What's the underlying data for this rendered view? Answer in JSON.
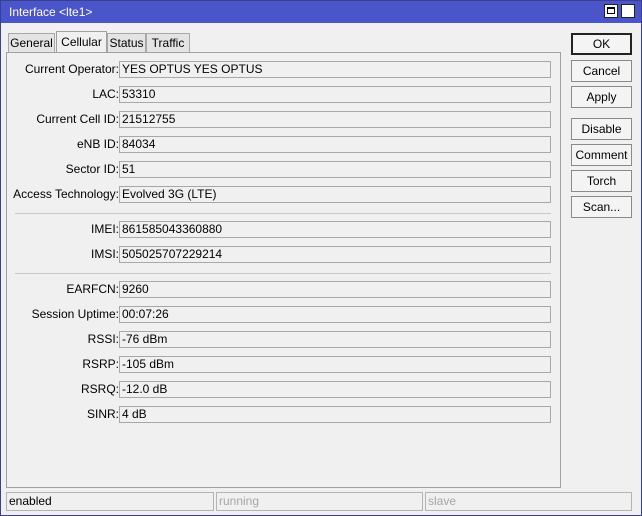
{
  "window": {
    "title": "Interface <lte1>"
  },
  "tabs": [
    {
      "label": "General"
    },
    {
      "label": "Cellular"
    },
    {
      "label": "Status"
    },
    {
      "label": "Traffic"
    }
  ],
  "fields": {
    "current_operator": {
      "label": "Current Operator:",
      "value": "YES OPTUS YES OPTUS"
    },
    "lac": {
      "label": "LAC:",
      "value": "53310"
    },
    "current_cell_id": {
      "label": "Current Cell ID:",
      "value": "21512755"
    },
    "enb_id": {
      "label": "eNB ID:",
      "value": "84034"
    },
    "sector_id": {
      "label": "Sector ID:",
      "value": "51"
    },
    "access_technology": {
      "label": "Access Technology:",
      "value": "Evolved 3G (LTE)"
    },
    "imei": {
      "label": "IMEI:",
      "value": "861585043360880"
    },
    "imsi": {
      "label": "IMSI:",
      "value": "505025707229214"
    },
    "earfcn": {
      "label": "EARFCN:",
      "value": "9260"
    },
    "session_uptime": {
      "label": "Session Uptime:",
      "value": "00:07:26"
    },
    "rssi": {
      "label": "RSSI:",
      "value": "-76 dBm"
    },
    "rsrp": {
      "label": "RSRP:",
      "value": "-105 dBm"
    },
    "rsrq": {
      "label": "RSRQ:",
      "value": "-12.0 dB"
    },
    "sinr": {
      "label": "SINR:",
      "value": "4 dB"
    }
  },
  "buttons": {
    "ok": "OK",
    "cancel": "Cancel",
    "apply": "Apply",
    "disable": "Disable",
    "comment": "Comment",
    "torch": "Torch",
    "scan": "Scan..."
  },
  "statusbar": {
    "state": "enabled",
    "running": "running",
    "slave": "slave"
  }
}
